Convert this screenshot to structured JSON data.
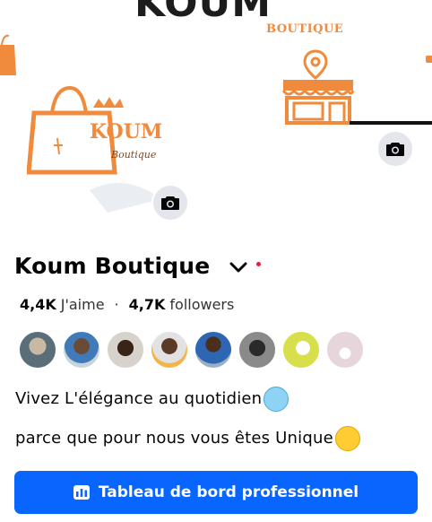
{
  "cover": {
    "title": "KOUM",
    "subtitle": "BOUTIQUE"
  },
  "logo": {
    "line1": "KOUM",
    "line2": "Boutique"
  },
  "profile": {
    "name": "Koum Boutique",
    "likes_value": "4,4K",
    "likes_label": "J'aime",
    "separator": "·",
    "followers_value": "4,7K",
    "followers_label": "followers",
    "bio_line1": "Vivez L'élégance au quotidien",
    "bio_line2": "parce que pour nous vous êtes Unique"
  },
  "friends": [
    "friend-1",
    "friend-2",
    "friend-3",
    "friend-4",
    "friend-5",
    "friend-6",
    "friend-7",
    "friend-8"
  ],
  "dashboard_button": {
    "label": "Tableau de bord professionnel",
    "icon": "dashboard-icon"
  },
  "colors": {
    "accent": "#0866ff",
    "brand_orange": "#f08a3c",
    "status_dot": "#e41e3f"
  }
}
